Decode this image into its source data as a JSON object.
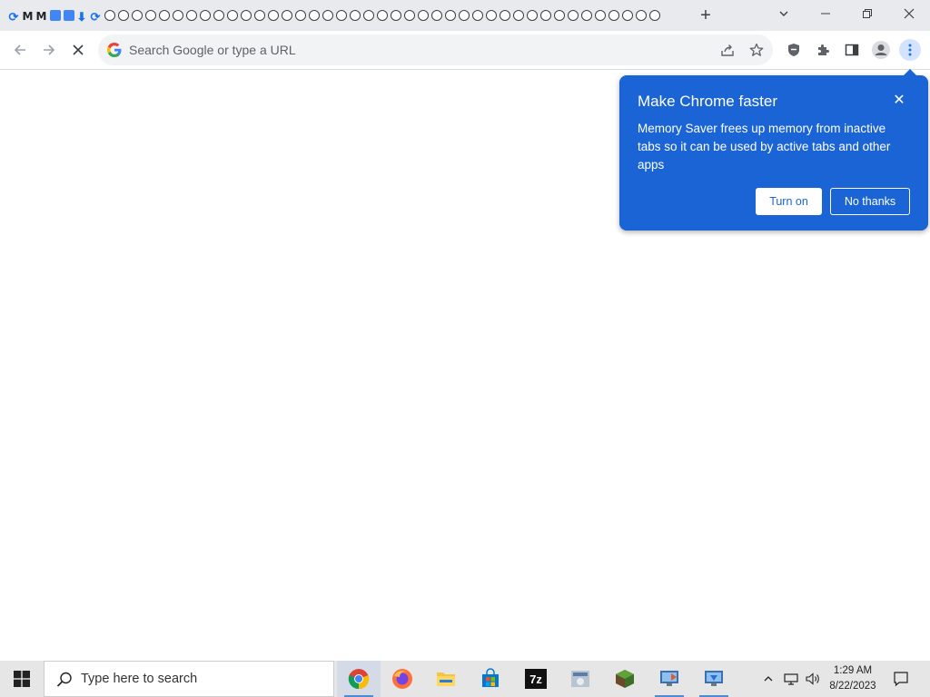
{
  "browser": {
    "tab_count": 48,
    "new_tab_symbol": "+",
    "omnibox": {
      "placeholder": "Search Google or type a URL"
    }
  },
  "popup": {
    "title": "Make Chrome faster",
    "body": "Memory Saver frees up memory from inactive tabs so it can be used by active tabs and other apps",
    "turn_on_label": "Turn on",
    "no_thanks_label": "No thanks",
    "close_symbol": "✕"
  },
  "taskbar": {
    "search_placeholder": "Type here to search",
    "time": "1:29 AM",
    "date": "8/22/2023",
    "apps": [
      "chrome-icon",
      "firefox-icon",
      "file-explorer-icon",
      "microsoft-store-icon",
      "7zip-icon",
      "app-icon",
      "minecraft-icon",
      "app-icon",
      "app-icon"
    ]
  },
  "colors": {
    "popup_bg": "#1a64d6",
    "tabstrip_bg": "#e8eaed",
    "taskbar_bg": "#e6e6e6"
  }
}
